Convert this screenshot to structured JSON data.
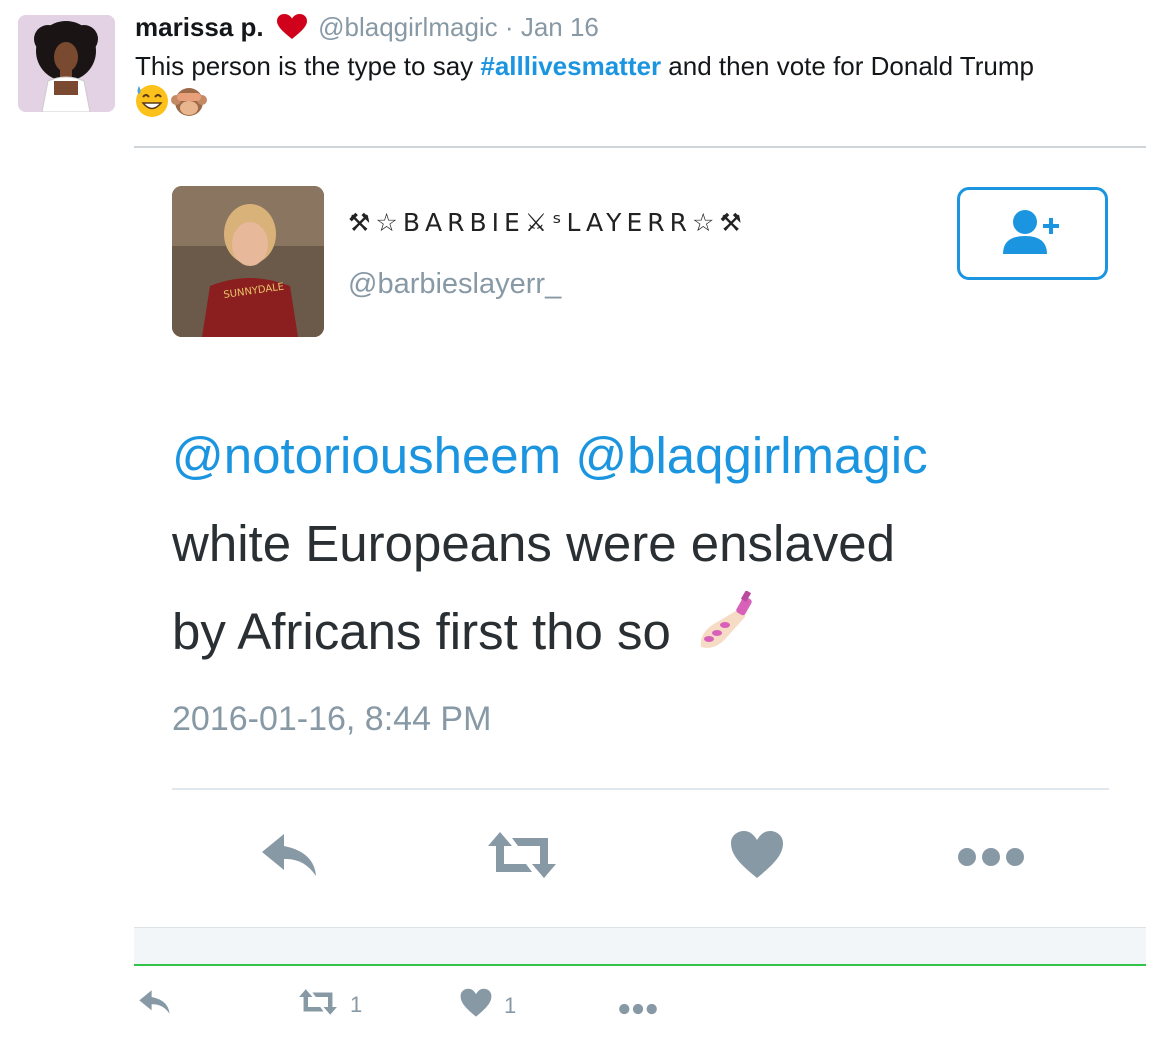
{
  "tweet": {
    "display_name": "marissa p.",
    "handle": "@blaqgirlmagic",
    "separator": "·",
    "date": "Jan 16",
    "text_before": "This person is the type to say ",
    "hashtag": "#alllivesmatter",
    "text_after": " and then vote for Donald Trump",
    "emojis": [
      "sweat-smile-emoji",
      "see-no-evil-monkey-emoji"
    ]
  },
  "embedded": {
    "display_name": "⚒☆BARBIE⚔ˢLAYERR☆⚒",
    "handle": "@barbieslayerr_",
    "mention_1": "@notoriousheem",
    "mention_2": "@blaqgirlmagic",
    "line_2": "white Europeans were enslaved",
    "line_3": "by Africans first tho so",
    "timestamp": "2016-01-16, 8:44 PM",
    "follow_icon": "add-user-icon"
  },
  "actions": {
    "retweet_count": "1",
    "like_count": "1"
  },
  "colors": {
    "link": "#1b95e0",
    "muted": "#8899a6",
    "heart": "#e0245e"
  }
}
